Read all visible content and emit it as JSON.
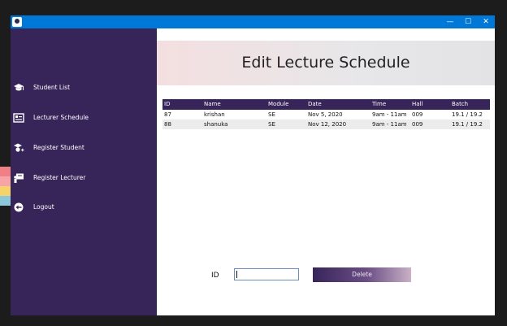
{
  "window": {
    "minimize_glyph": "—",
    "maximize_glyph": "☐",
    "close_glyph": "✕"
  },
  "sidebar": {
    "items": [
      {
        "label": "Student List",
        "icon": "graduation-cap-icon"
      },
      {
        "label": "Lecturer Schedule",
        "icon": "schedule-board-icon"
      },
      {
        "label": "Register Student",
        "icon": "register-student-icon"
      },
      {
        "label": "Register Lecturer",
        "icon": "register-lecturer-icon"
      },
      {
        "label": "Logout",
        "icon": "logout-icon"
      }
    ]
  },
  "header": {
    "title": "Edit Lecture Schedule"
  },
  "table": {
    "columns": [
      "ID",
      "Name",
      "Module",
      "Date",
      "Time",
      "Hall",
      "Batch"
    ],
    "rows": [
      [
        "87",
        "krishan",
        "SE",
        "Nov 5, 2020",
        "9am - 11am",
        "009",
        "19.1 / 19.2"
      ],
      [
        "88",
        "shanuka",
        "SE",
        "Nov 12, 2020",
        "9am - 11am",
        "009",
        "19.1 / 19.2"
      ]
    ]
  },
  "form": {
    "id_label": "ID",
    "id_value": "",
    "delete_label": "Delete"
  },
  "colors": {
    "titlebar": "#0078d7",
    "sidebar": "#37255a",
    "table_header": "#37255a"
  }
}
